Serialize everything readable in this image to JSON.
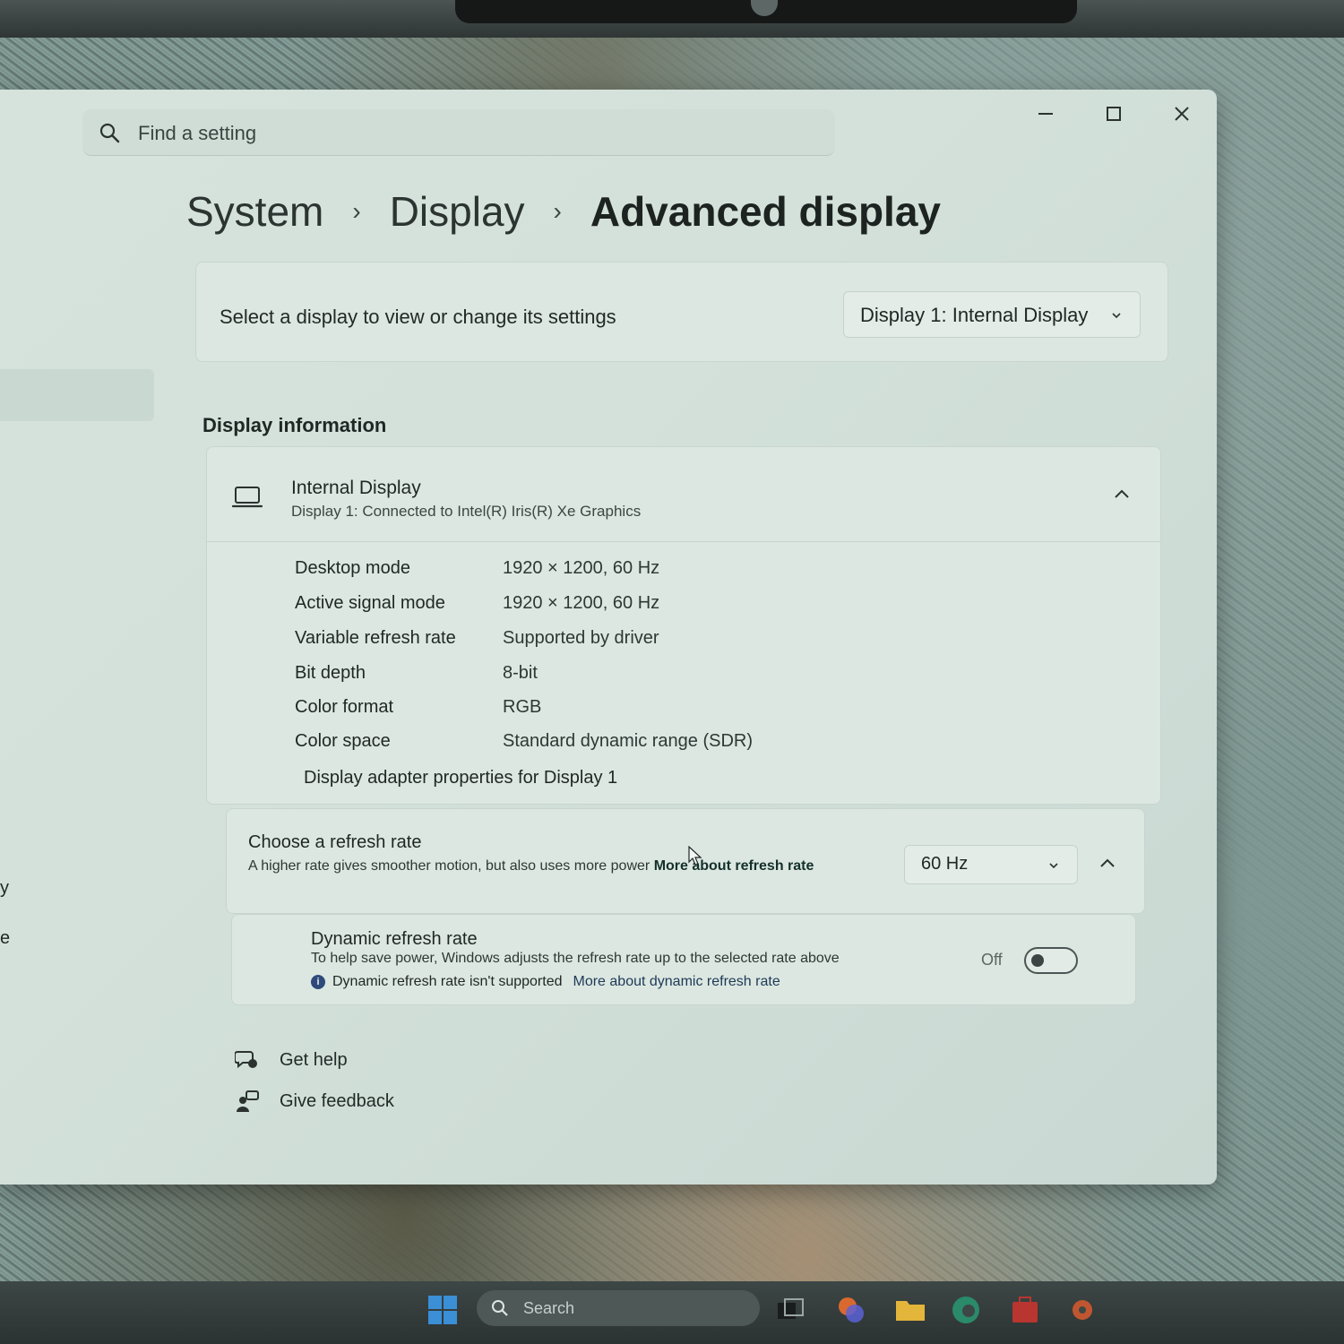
{
  "search": {
    "placeholder": "Find a setting"
  },
  "window_controls": {
    "minimize": "minimize",
    "maximize": "maximize",
    "close": "close"
  },
  "breadcrumb": {
    "items": [
      "System",
      "Display",
      "Advanced display"
    ],
    "separator": "›"
  },
  "select_display": {
    "label": "Select a display to view or change its settings",
    "selected": "Display 1: Internal Display"
  },
  "display_information": {
    "section_title": "Display information",
    "title": "Internal Display",
    "subtitle": "Display 1: Connected to Intel(R) Iris(R) Xe Graphics",
    "rows": [
      {
        "key": "Desktop mode",
        "value": "1920 × 1200, 60 Hz"
      },
      {
        "key": "Active signal mode",
        "value": "1920 × 1200, 60 Hz"
      },
      {
        "key": "Variable refresh rate",
        "value": "Supported by driver"
      },
      {
        "key": "Bit depth",
        "value": "8-bit"
      },
      {
        "key": "Color format",
        "value": "RGB"
      },
      {
        "key": "Color space",
        "value": "Standard dynamic range (SDR)"
      }
    ],
    "adapter_link": "Display adapter properties for Display 1"
  },
  "refresh_rate": {
    "title": "Choose a refresh rate",
    "description": "A higher rate gives smoother motion, but also uses more power",
    "link": "More about refresh rate",
    "selected": "60 Hz"
  },
  "dynamic_refresh": {
    "title": "Dynamic refresh rate",
    "description": "To help save power, Windows adjusts the refresh rate up to the selected rate above",
    "note": "Dynamic refresh rate isn't supported",
    "link": "More about dynamic refresh rate",
    "toggle_state": "Off"
  },
  "footer": {
    "get_help": "Get help",
    "give_feedback": "Give feedback"
  },
  "left_nav_fragments": [
    "y",
    "e"
  ],
  "taskbar": {
    "search_label": "Search",
    "icons": [
      "start-icon",
      "task-view-icon",
      "copilot-icon",
      "file-explorer-icon",
      "edge-icon",
      "store-icon",
      "settings-icon"
    ]
  },
  "colors": {
    "window_bg": "#d4e1db",
    "card_bg": "#dce7e1",
    "text": "#1f2725",
    "info_accent": "#2d4a7a"
  }
}
